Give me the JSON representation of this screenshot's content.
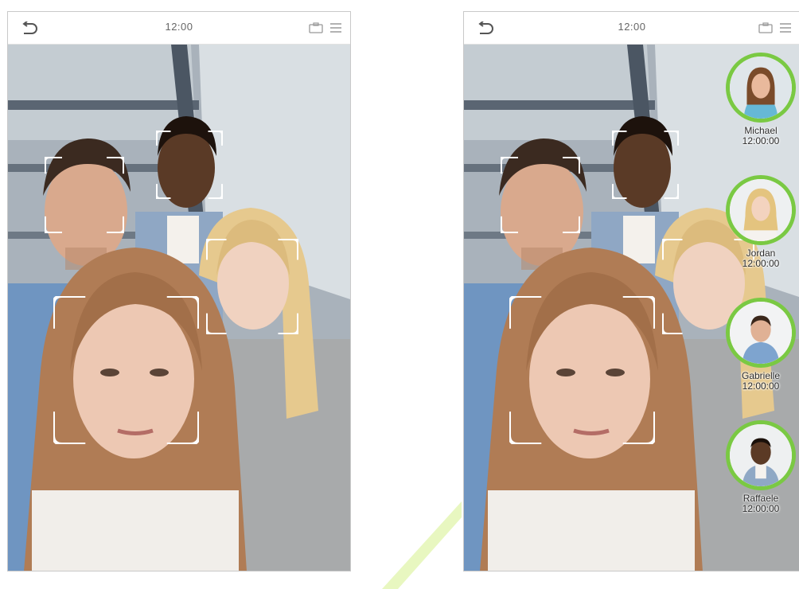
{
  "colors": {
    "accent_ring": "#7ac943",
    "frame_line": "#ffffff",
    "status_text": "#666666"
  },
  "left_screen": {
    "status_bar": {
      "time": "12:00",
      "back_icon": "back-arrow-icon",
      "right_icons": [
        "camera-icon",
        "menu-icon"
      ]
    },
    "detected_faces": 4
  },
  "right_screen": {
    "status_bar": {
      "time": "12:00",
      "back_icon": "back-arrow-icon",
      "right_icons": [
        "camera-icon",
        "menu-icon"
      ]
    },
    "detected_faces": 4,
    "recognized_users": [
      {
        "name": "Michael",
        "time": "12:00:00",
        "avatar": "woman-dark-hair-avatar"
      },
      {
        "name": "Jordan",
        "time": "12:00:00",
        "avatar": "woman-blonde-avatar"
      },
      {
        "name": "Gabrielle",
        "time": "12:00:00",
        "avatar": "man-brown-hair-avatar"
      },
      {
        "name": "Raffaele",
        "time": "12:00:00",
        "avatar": "man-dark-skin-avatar"
      }
    ]
  }
}
